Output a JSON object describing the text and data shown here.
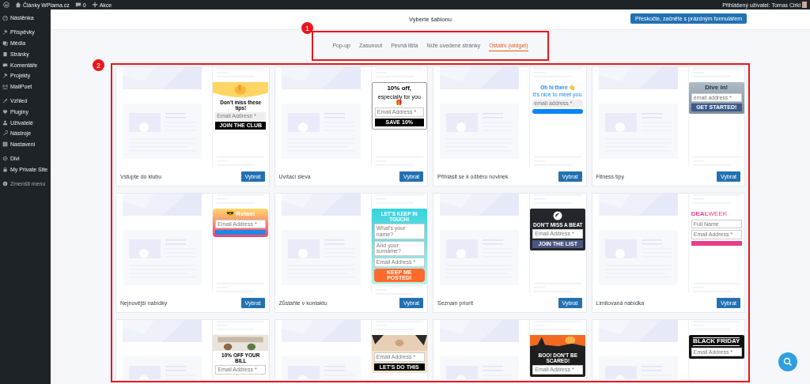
{
  "admin_bar": {
    "site": "Články WPlama.cz",
    "comments": "0",
    "new": "Akce",
    "user": "Přihlášený uživatel: Tomas Cirkl"
  },
  "sidebar": {
    "groups": [
      [
        {
          "label": "Nástěnka"
        }
      ],
      [
        {
          "label": "Příspěvky"
        },
        {
          "label": "Média"
        },
        {
          "label": "Stránky"
        },
        {
          "label": "Komentáře"
        },
        {
          "label": "Projekty"
        },
        {
          "label": "MailPoet"
        }
      ],
      [
        {
          "label": "Vzhled"
        },
        {
          "label": "Pluginy"
        },
        {
          "label": "Uživatelé"
        },
        {
          "label": "Nástroje"
        },
        {
          "label": "Nastavení"
        }
      ],
      [
        {
          "label": "Divi"
        },
        {
          "label": "My Private Site"
        }
      ]
    ],
    "collapse": "Zmenšit menu"
  },
  "header": {
    "title": "Vyberte šablonu",
    "button": "Přeskočte, začněte s prázdným formulářem"
  },
  "tabs": [
    {
      "label": "Pop-up",
      "selected": false
    },
    {
      "label": "Zasunout",
      "selected": false
    },
    {
      "label": "Pevná lišta",
      "selected": false
    },
    {
      "label": "Níže uvedené stránky",
      "selected": false
    },
    {
      "label": "Ostatní (widget)",
      "selected": true
    }
  ],
  "annotations": [
    "1",
    "2"
  ],
  "templates": [
    {
      "name": "Vstupte do klubu",
      "button": "Vybrat",
      "preview": {
        "kind": "yellow",
        "picture": true,
        "heading": "Don't miss these tips!",
        "fields": [
          "Email Address *"
        ],
        "button": "JOIN THE CLUB"
      }
    },
    {
      "name": "Uvítací sleva",
      "button": "Vybrat",
      "preview": {
        "kind": "outline",
        "heading": "10% off,",
        "subheading": "especially for you 🎁",
        "fields": [
          "Email Address *"
        ],
        "button": "SAVE 10%"
      }
    },
    {
      "name": "Přihlásit se k odběru novinek",
      "button": "Vybrat",
      "preview": {
        "kind": "blue",
        "heading": "Oh hi there 👋",
        "subheading": "It's nice to meet you.",
        "fields": [
          "email address *"
        ]
      }
    },
    {
      "name": "Fitness tipy",
      "button": "Vybrat",
      "preview": {
        "heading": "Dive in!",
        "fields": [
          "email address *"
        ],
        "button": "GET STARTED!"
      }
    },
    {
      "name": "Nejnovější nabídky",
      "button": "Vybrat",
      "preview": {
        "kind": "gradient",
        "heading": "😎 Relax!",
        "fields": [
          "Email Address *"
        ]
      }
    },
    {
      "name": "Zůstaňte v kontaktu",
      "button": "Vybrat",
      "preview": {
        "kind": "teal",
        "heading": "LET'S KEEP IN TOUCH!",
        "fields": [
          "What's your name?",
          "And your surname?",
          "Email Address *"
        ],
        "button": "KEEP ME POSTED!"
      }
    },
    {
      "name": "Seznam priorit",
      "button": "Vybrat",
      "preview": {
        "kind": "dark",
        "heading": "DON'T MISS A BEAT",
        "fields": [
          "Email Address *"
        ],
        "button": "JOIN THE LIST"
      }
    },
    {
      "name": "Limitovaná nabídka",
      "button": "Vybrat",
      "preview": {
        "kind": "deal",
        "heading": "**DEAL**WEEK",
        "fields": [
          "Full Name",
          "Email Address *"
        ]
      }
    },
    {
      "preview": {
        "kind": "bill",
        "picture": true,
        "heading": "10% OFF YOUR BILL",
        "fields": [
          "Email Address *"
        ]
      }
    },
    {
      "preview": {
        "kind": "cream",
        "picture": true,
        "fields": [
          "Email Address *"
        ],
        "button": "LET'S DO THIS"
      }
    },
    {
      "preview": {
        "kind": "halloween",
        "picture": true,
        "heading": "BOO! DON'T BE SCARED!",
        "fields": [
          "Email Address *"
        ]
      }
    },
    {
      "preview": {
        "kind": "blackfriday",
        "heading": "BLACK FRIDAY",
        "fields": [
          "Email Address *"
        ]
      }
    }
  ]
}
